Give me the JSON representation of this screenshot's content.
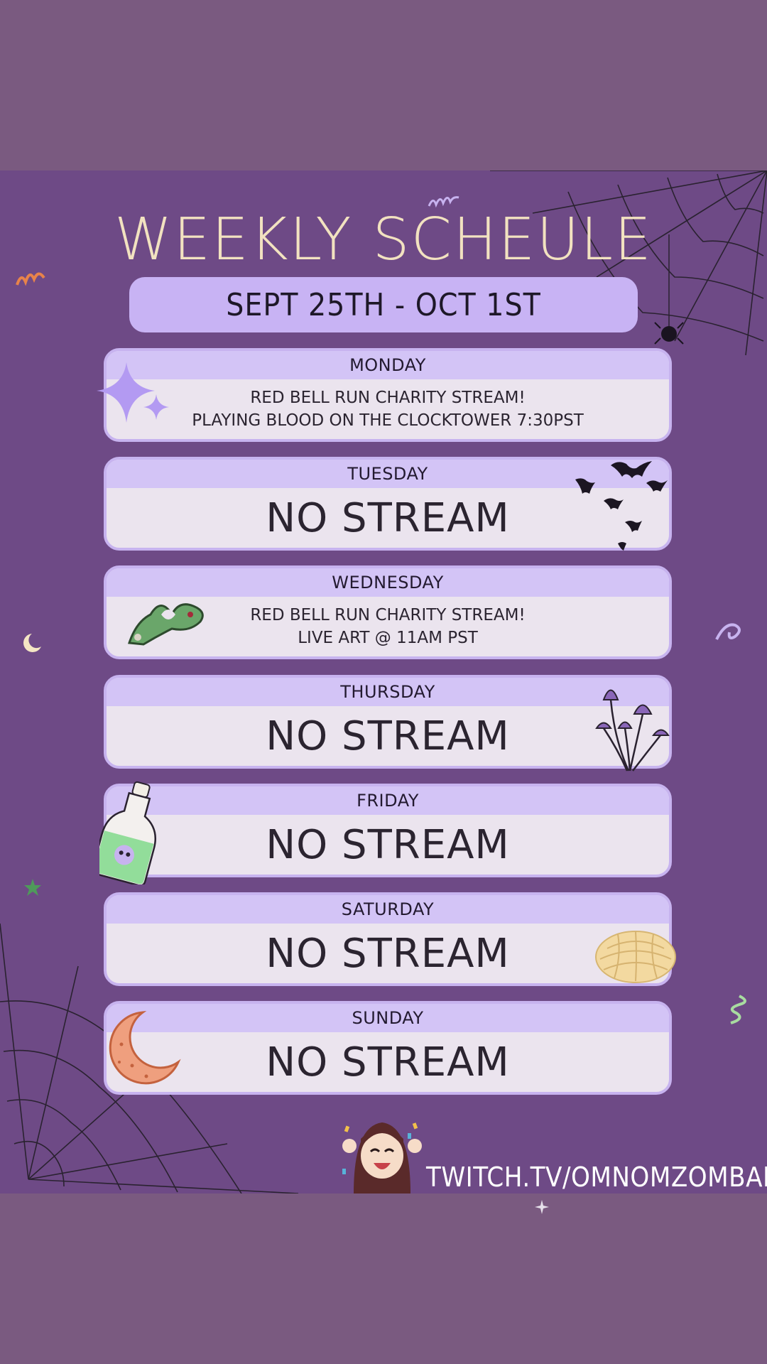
{
  "title": "WEEKLY SCHEULE",
  "date_range": "SEPT 25TH - OCT 1ST",
  "days": [
    {
      "day": "MONDAY",
      "line1": "RED BELL RUN CHARITY STREAM!",
      "line2": "PLAYING BLOOD ON THE CLOCKTOWER 7:30PST"
    },
    {
      "day": "TUESDAY",
      "status": "NO STREAM"
    },
    {
      "day": "WEDNESDAY",
      "line1": "RED BELL RUN CHARITY STREAM!",
      "line2": "LIVE ART @ 11AM PST"
    },
    {
      "day": "THURSDAY",
      "status": "NO STREAM"
    },
    {
      "day": "FRIDAY",
      "status": "NO STREAM"
    },
    {
      "day": "SATURDAY",
      "status": "NO STREAM"
    },
    {
      "day": "SUNDAY",
      "status": "NO STREAM"
    }
  ],
  "footer": {
    "link": "TWITCH.TV/OMNOMZOMBABE"
  },
  "colors": {
    "background": "#6e4a86",
    "card": "#ebe4ee",
    "card_header": "#d3c4f6",
    "title": "#f2e2c0"
  }
}
